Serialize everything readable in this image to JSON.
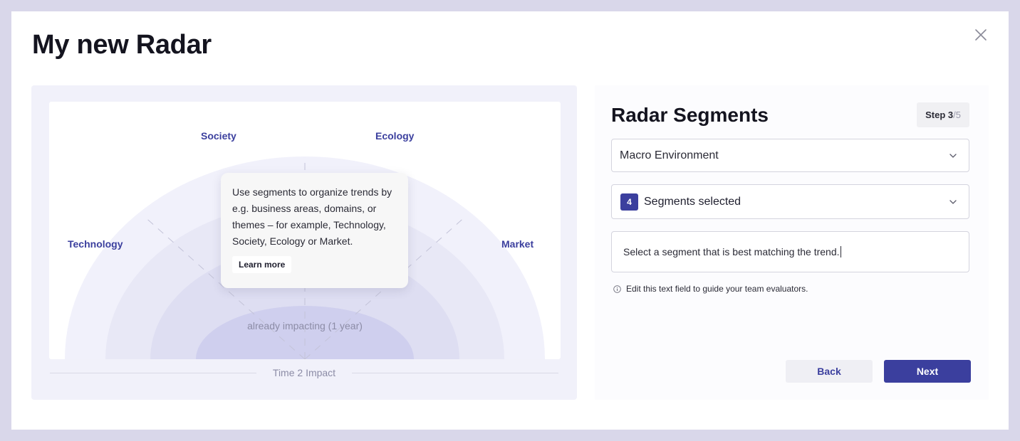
{
  "modal": {
    "title": "My new Radar",
    "close_icon": "close-icon"
  },
  "preview": {
    "segments": [
      "Society",
      "Ecology",
      "Technology",
      "Market"
    ],
    "ring_label": "already impacting (1 year)",
    "axis_label": "Time 2 Impact",
    "tooltip": {
      "text": "Use segments to organize trends by e.g. business areas, domains, or themes – for example, Technology, Society, Ecology or Market.",
      "learn_more": "Learn more"
    },
    "colors": {
      "ring_outer": "#f1f1fb",
      "ring_middle": "#e6e6f4",
      "ring_inner": "#dcdcf0",
      "ring_core": "#cbcbeb",
      "segment_label": "#3b3f9e"
    }
  },
  "panel": {
    "title": "Radar Segments",
    "step": {
      "prefix": "Step 3",
      "total": "/5"
    },
    "template_select": {
      "value": "Macro Environment",
      "icon": "chevron-down-icon"
    },
    "segments_select": {
      "count": "4",
      "value": "Segments selected",
      "icon": "chevron-down-icon"
    },
    "description": {
      "value": "Select a segment that is best matching the trend."
    },
    "hint": {
      "icon": "info-icon",
      "text": "Edit this text field to guide your team evaluators."
    },
    "back_label": "Back",
    "next_label": "Next",
    "accent": "#3b3f9e"
  }
}
